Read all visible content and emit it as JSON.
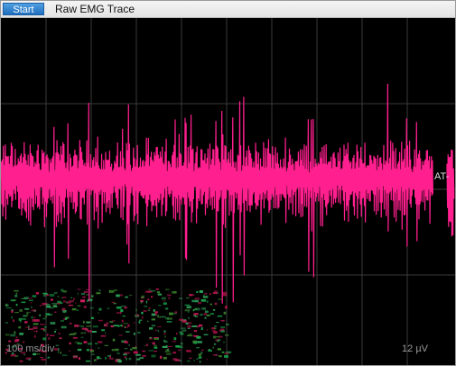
{
  "toolbar": {
    "start_label": "Start",
    "title": "Raw EMG Trace"
  },
  "scope": {
    "time_scale": "100 ms/div",
    "amplitude_scale": "12 µV",
    "channel_marker": "AT-",
    "trace_color": "#ff1f8e",
    "grid_color": "#3a3a3a"
  }
}
